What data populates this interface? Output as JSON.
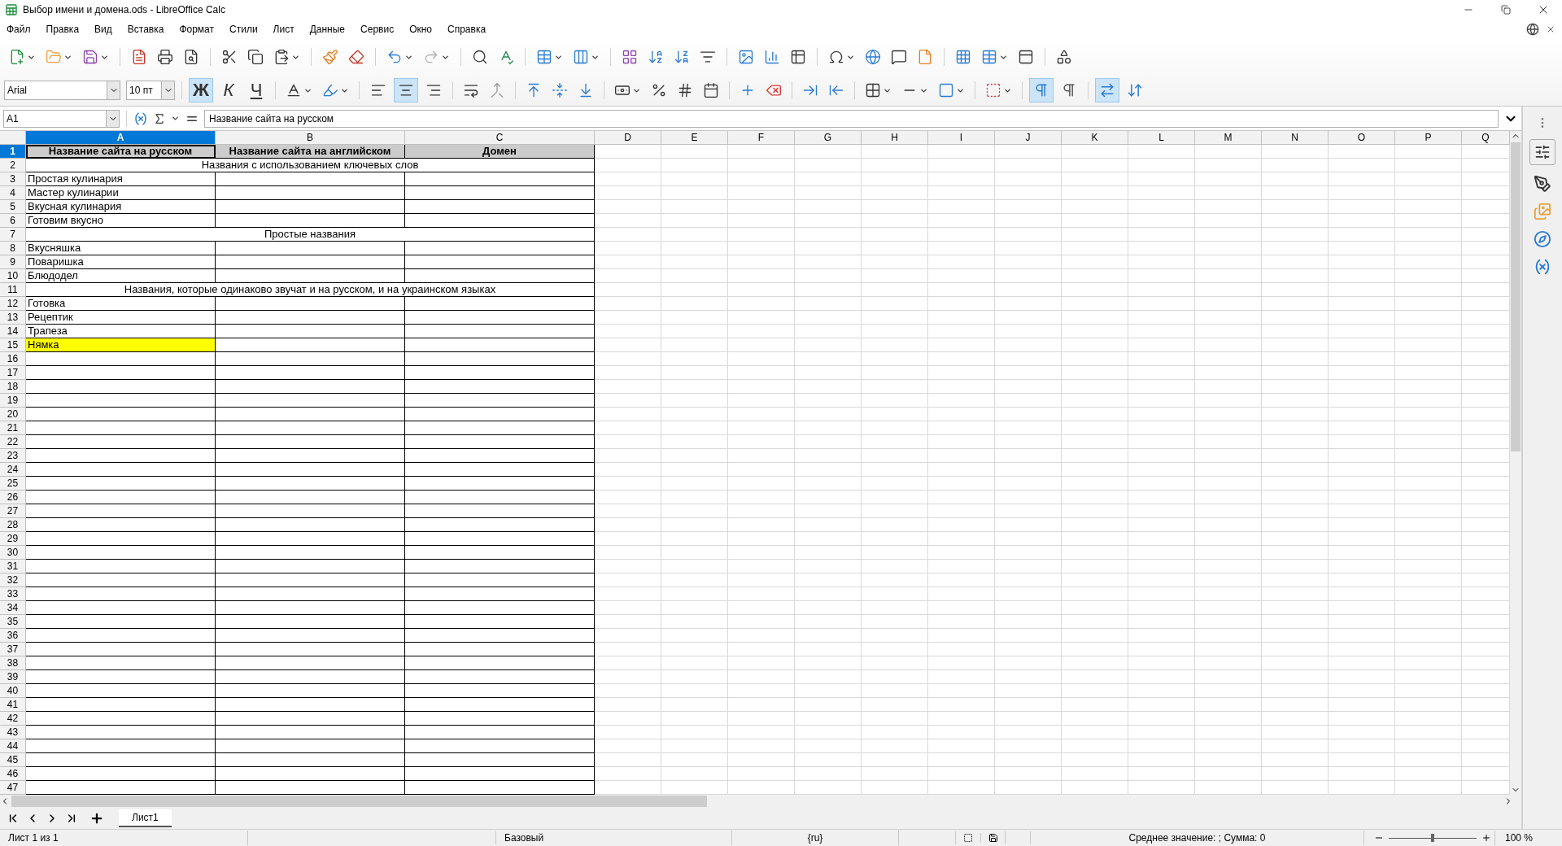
{
  "window": {
    "title": "Выбор имени и домена.ods - LibreOffice Calc"
  },
  "menu": [
    {
      "label": "Файл"
    },
    {
      "label": "Правка"
    },
    {
      "label": "Вид"
    },
    {
      "label": "Вставка"
    },
    {
      "label": "Формат"
    },
    {
      "label": "Стили"
    },
    {
      "label": "Лист"
    },
    {
      "label": "Данные"
    },
    {
      "label": "Сервис"
    },
    {
      "label": "Окно"
    },
    {
      "label": "Справка"
    }
  ],
  "formatting": {
    "font_name": "Arial",
    "font_size": "10 пт",
    "styles": [
      {
        "label": "Ж",
        "kind": "bold",
        "selected": true
      },
      {
        "label": "К",
        "kind": "italic",
        "selected": false
      },
      {
        "label": "Ч",
        "kind": "underline",
        "selected": false
      }
    ],
    "alignment": [
      {
        "kind": "left",
        "selected": false
      },
      {
        "kind": "center",
        "selected": true
      },
      {
        "kind": "right",
        "selected": false
      }
    ],
    "paragraph_direction": [
      {
        "kind": "ltr",
        "selected": true
      },
      {
        "kind": "rtl",
        "selected": false
      }
    ],
    "text_direction": [
      {
        "kind": "horizontal",
        "selected": true
      },
      {
        "kind": "vertical",
        "selected": false
      }
    ]
  },
  "formula_bar": {
    "name_box": "A1",
    "content": "Название сайта на русском"
  },
  "columns": [
    {
      "label": "A",
      "selected": true
    },
    {
      "label": "B",
      "selected": false
    },
    {
      "label": "C",
      "selected": false
    },
    {
      "label": "D",
      "selected": false
    },
    {
      "label": "E",
      "selected": false
    },
    {
      "label": "F",
      "selected": false
    },
    {
      "label": "G",
      "selected": false
    },
    {
      "label": "H",
      "selected": false
    },
    {
      "label": "I",
      "selected": false
    },
    {
      "label": "J",
      "selected": false
    },
    {
      "label": "K",
      "selected": false
    },
    {
      "label": "L",
      "selected": false
    },
    {
      "label": "M",
      "selected": false
    },
    {
      "label": "N",
      "selected": false
    },
    {
      "label": "O",
      "selected": false
    },
    {
      "label": "P",
      "selected": false
    },
    {
      "label": "Q",
      "selected": false
    }
  ],
  "rows": [
    {
      "number": "1",
      "selected": true,
      "kind": "header",
      "cells": [
        "Название сайта на русском",
        "Название сайта на английском",
        "Домен"
      ]
    },
    {
      "number": "2",
      "selected": false,
      "kind": "section",
      "text": "Названия с использованием ключевых слов"
    },
    {
      "number": "3",
      "selected": false,
      "kind": "entry",
      "text": "Простая кулинария",
      "highlighted": false
    },
    {
      "number": "4",
      "selected": false,
      "kind": "entry",
      "text": "Мастер кулинарии",
      "highlighted": false
    },
    {
      "number": "5",
      "selected": false,
      "kind": "entry",
      "text": "Вкусная кулинария",
      "highlighted": false
    },
    {
      "number": "6",
      "selected": false,
      "kind": "entry",
      "text": "Готовим вкусно",
      "highlighted": false
    },
    {
      "number": "7",
      "selected": false,
      "kind": "section",
      "text": "Простые названия"
    },
    {
      "number": "8",
      "selected": false,
      "kind": "entry",
      "text": "Вкусняшка",
      "highlighted": false
    },
    {
      "number": "9",
      "selected": false,
      "kind": "entry",
      "text": "Поваришка",
      "highlighted": false
    },
    {
      "number": "10",
      "selected": false,
      "kind": "entry",
      "text": "Блюдодел",
      "highlighted": false
    },
    {
      "number": "11",
      "selected": false,
      "kind": "section",
      "text": "Названия, которые одинаково звучат и на русском, и на украинском языках"
    },
    {
      "number": "12",
      "selected": false,
      "kind": "entry",
      "text": "Готовка",
      "highlighted": false
    },
    {
      "number": "13",
      "selected": false,
      "kind": "entry",
      "text": "Рецептик",
      "highlighted": false
    },
    {
      "number": "14",
      "selected": false,
      "kind": "entry",
      "text": "Трапеза",
      "highlighted": false
    },
    {
      "number": "15",
      "selected": false,
      "kind": "entry",
      "text": "Нямка",
      "highlighted": true
    },
    {
      "number": "16",
      "selected": false,
      "kind": "blank"
    },
    {
      "number": "17",
      "selected": false,
      "kind": "blank"
    },
    {
      "number": "18",
      "selected": false,
      "kind": "blank"
    },
    {
      "number": "19",
      "selected": false,
      "kind": "blank"
    },
    {
      "number": "20",
      "selected": false,
      "kind": "blank"
    },
    {
      "number": "21",
      "selected": false,
      "kind": "blank"
    },
    {
      "number": "22",
      "selected": false,
      "kind": "blank"
    },
    {
      "number": "23",
      "selected": false,
      "kind": "blank"
    },
    {
      "number": "24",
      "selected": false,
      "kind": "blank"
    },
    {
      "number": "25",
      "selected": false,
      "kind": "blank"
    },
    {
      "number": "26",
      "selected": false,
      "kind": "blank"
    },
    {
      "number": "27",
      "selected": false,
      "kind": "blank"
    },
    {
      "number": "28",
      "selected": false,
      "kind": "blank"
    },
    {
      "number": "29",
      "selected": false,
      "kind": "blank"
    },
    {
      "number": "30",
      "selected": false,
      "kind": "blank"
    },
    {
      "number": "31",
      "selected": false,
      "kind": "blank"
    },
    {
      "number": "32",
      "selected": false,
      "kind": "blank"
    },
    {
      "number": "33",
      "selected": false,
      "kind": "blank"
    },
    {
      "number": "34",
      "selected": false,
      "kind": "blank"
    },
    {
      "number": "35",
      "selected": false,
      "kind": "blank"
    },
    {
      "number": "36",
      "selected": false,
      "kind": "blank"
    },
    {
      "number": "37",
      "selected": false,
      "kind": "blank"
    },
    {
      "number": "38",
      "selected": false,
      "kind": "blank"
    },
    {
      "number": "39",
      "selected": false,
      "kind": "blank"
    },
    {
      "number": "40",
      "selected": false,
      "kind": "blank"
    },
    {
      "number": "41",
      "selected": false,
      "kind": "blank"
    },
    {
      "number": "42",
      "selected": false,
      "kind": "blank"
    },
    {
      "number": "43",
      "selected": false,
      "kind": "blank"
    },
    {
      "number": "44",
      "selected": false,
      "kind": "blank"
    },
    {
      "number": "45",
      "selected": false,
      "kind": "blank"
    },
    {
      "number": "46",
      "selected": false,
      "kind": "blank"
    },
    {
      "number": "47",
      "selected": false,
      "kind": "blank"
    }
  ],
  "sheet_tabs": [
    {
      "label": "Лист1",
      "selected": true
    }
  ],
  "status_bar": {
    "sheet": "Лист 1 из 1",
    "page_style": "Базовый",
    "language": "{ru}",
    "summary": "Среднее значение: ; Сумма: 0",
    "zoom": {
      "level": 0.5,
      "reading": "100 %"
    }
  }
}
